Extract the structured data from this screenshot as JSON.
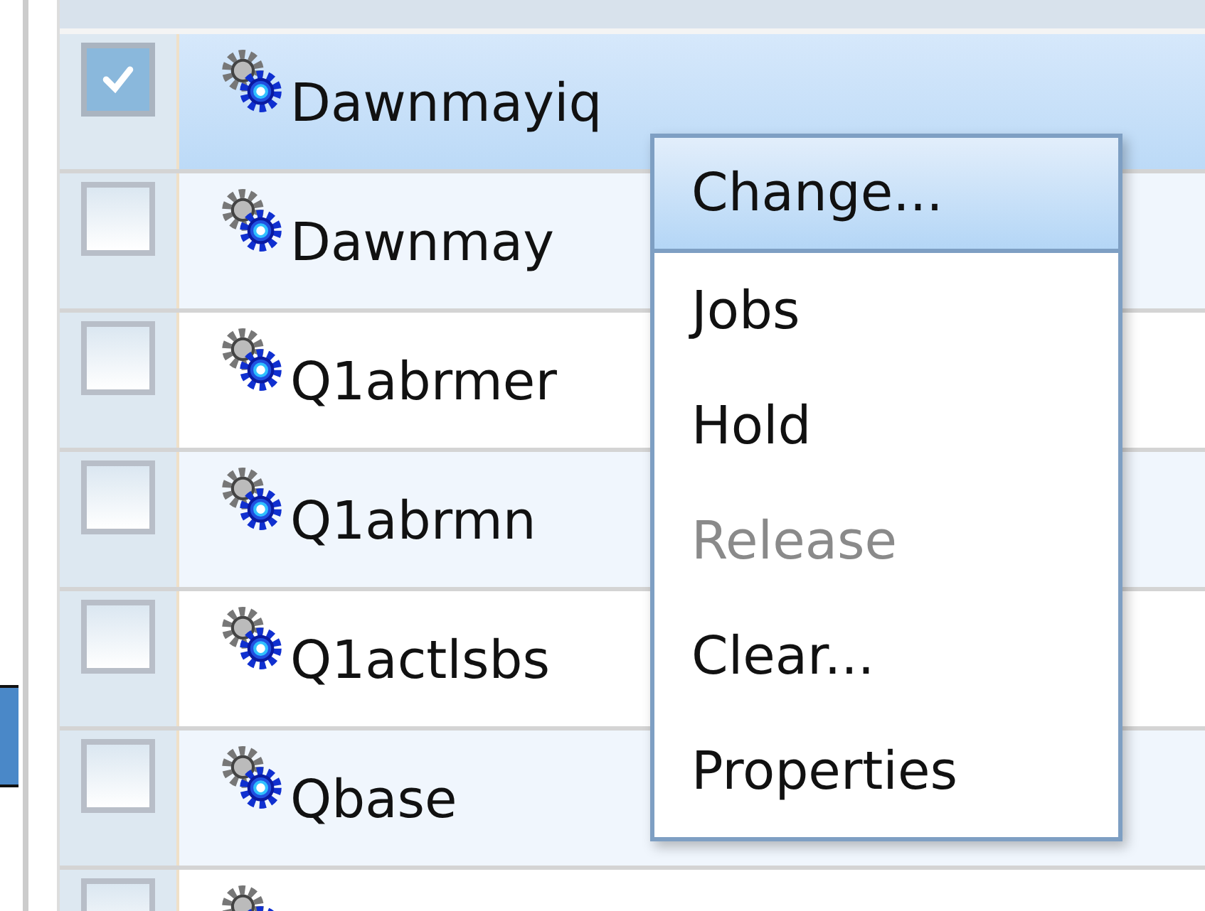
{
  "table": {
    "rows": [
      {
        "name": "Dawnmayiq",
        "checked": true,
        "selected": true
      },
      {
        "name": "Dawnmay",
        "checked": false,
        "selected": false
      },
      {
        "name": "Q1abrmer",
        "checked": false,
        "selected": false
      },
      {
        "name": "Q1abrmn",
        "checked": false,
        "selected": false
      },
      {
        "name": "Q1actlsbs",
        "checked": false,
        "selected": false
      },
      {
        "name": "Qbase",
        "checked": false,
        "selected": false
      },
      {
        "checked": false,
        "selected": false
      }
    ]
  },
  "context_menu": {
    "items": [
      {
        "label": "Change...",
        "selected": true,
        "disabled": false
      },
      {
        "label": "Jobs",
        "selected": false,
        "disabled": false
      },
      {
        "label": "Hold",
        "selected": false,
        "disabled": false
      },
      {
        "label": "Release",
        "selected": false,
        "disabled": true
      },
      {
        "label": "Clear...",
        "selected": false,
        "disabled": false
      },
      {
        "label": "Properties",
        "selected": false,
        "disabled": false
      }
    ]
  }
}
